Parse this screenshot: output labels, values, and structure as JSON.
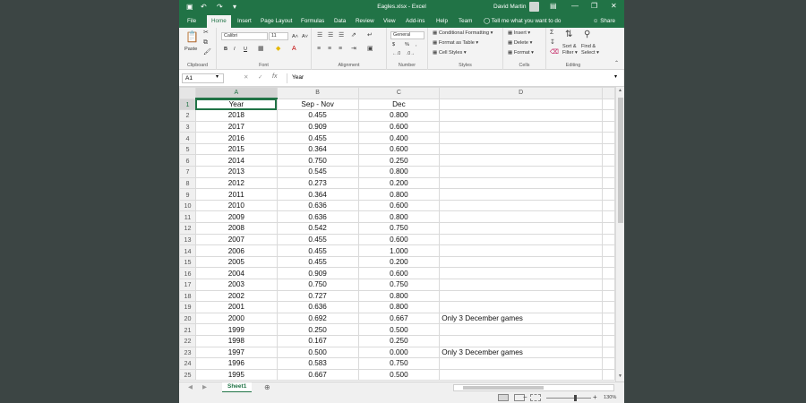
{
  "window": {
    "title": "Eagles.xlsx  -  Excel",
    "user": "David Martin",
    "minimize_glyph": "—",
    "restore_glyph": "❐",
    "close_glyph": "✕"
  },
  "quick_access": {
    "save_glyph": "💾",
    "undo_glyph": "↶",
    "redo_glyph": "↷"
  },
  "tabs": [
    "File",
    "Home",
    "Insert",
    "Page Layout",
    "Formulas",
    "Data",
    "Review",
    "View",
    "Add-ins",
    "Help",
    "Team"
  ],
  "active_tab": "Home",
  "tell_me": "Tell me what you want to do",
  "share": "Share",
  "ribbon": {
    "clipboard": {
      "label": "Clipboard",
      "paste": "Paste"
    },
    "font": {
      "label": "Font",
      "name": "Calibri",
      "size": "11",
      "bold": "B",
      "italic": "I",
      "underline": "U",
      "grow": "A˄",
      "shrink": "A˅"
    },
    "alignment": {
      "label": "Alignment"
    },
    "number": {
      "label": "Number",
      "format": "General",
      "dollar": "$",
      "percent": "%",
      "comma": ","
    },
    "styles": {
      "label": "Styles",
      "conditional": "Conditional Formatting",
      "format_table": "Format as Table",
      "cell_styles": "Cell Styles"
    },
    "cells": {
      "label": "Cells",
      "insert": "Insert",
      "delete": "Delete",
      "format": "Format"
    },
    "editing": {
      "label": "Editing",
      "sum": "Σ",
      "sort": "Sort &",
      "filter": "Filter",
      "find": "Find &",
      "select": "Select"
    }
  },
  "formula_bar": {
    "name_box": "A1",
    "fx": "fx",
    "value": "Year"
  },
  "columns": [
    "A",
    "B",
    "C",
    "D"
  ],
  "rows": [
    {
      "n": "1",
      "a": "Year",
      "b": "Sep - Nov",
      "c": "Dec",
      "d": ""
    },
    {
      "n": "2",
      "a": "2018",
      "b": "0.455",
      "c": "0.800",
      "d": ""
    },
    {
      "n": "3",
      "a": "2017",
      "b": "0.909",
      "c": "0.600",
      "d": ""
    },
    {
      "n": "4",
      "a": "2016",
      "b": "0.455",
      "c": "0.400",
      "d": ""
    },
    {
      "n": "5",
      "a": "2015",
      "b": "0.364",
      "c": "0.600",
      "d": ""
    },
    {
      "n": "6",
      "a": "2014",
      "b": "0.750",
      "c": "0.250",
      "d": ""
    },
    {
      "n": "7",
      "a": "2013",
      "b": "0.545",
      "c": "0.800",
      "d": ""
    },
    {
      "n": "8",
      "a": "2012",
      "b": "0.273",
      "c": "0.200",
      "d": ""
    },
    {
      "n": "9",
      "a": "2011",
      "b": "0.364",
      "c": "0.800",
      "d": ""
    },
    {
      "n": "10",
      "a": "2010",
      "b": "0.636",
      "c": "0.600",
      "d": ""
    },
    {
      "n": "11",
      "a": "2009",
      "b": "0.636",
      "c": "0.800",
      "d": ""
    },
    {
      "n": "12",
      "a": "2008",
      "b": "0.542",
      "c": "0.750",
      "d": ""
    },
    {
      "n": "13",
      "a": "2007",
      "b": "0.455",
      "c": "0.600",
      "d": ""
    },
    {
      "n": "14",
      "a": "2006",
      "b": "0.455",
      "c": "1.000",
      "d": ""
    },
    {
      "n": "15",
      "a": "2005",
      "b": "0.455",
      "c": "0.200",
      "d": ""
    },
    {
      "n": "16",
      "a": "2004",
      "b": "0.909",
      "c": "0.600",
      "d": ""
    },
    {
      "n": "17",
      "a": "2003",
      "b": "0.750",
      "c": "0.750",
      "d": ""
    },
    {
      "n": "18",
      "a": "2002",
      "b": "0.727",
      "c": "0.800",
      "d": ""
    },
    {
      "n": "19",
      "a": "2001",
      "b": "0.636",
      "c": "0.800",
      "d": ""
    },
    {
      "n": "20",
      "a": "2000",
      "b": "0.692",
      "c": "0.667",
      "d": "Only 3 December games"
    },
    {
      "n": "21",
      "a": "1999",
      "b": "0.250",
      "c": "0.500",
      "d": ""
    },
    {
      "n": "22",
      "a": "1998",
      "b": "0.167",
      "c": "0.250",
      "d": ""
    },
    {
      "n": "23",
      "a": "1997",
      "b": "0.500",
      "c": "0.000",
      "d": "Only 3 December games"
    },
    {
      "n": "24",
      "a": "1996",
      "b": "0.583",
      "c": "0.750",
      "d": ""
    },
    {
      "n": "25",
      "a": "1995",
      "b": "0.667",
      "c": "0.500",
      "d": ""
    }
  ],
  "sheet_tab": "Sheet1",
  "add_sheet": "⊕",
  "zoom": "130%",
  "colors": {
    "brand_green": "#217346",
    "background": "#3c4544"
  }
}
